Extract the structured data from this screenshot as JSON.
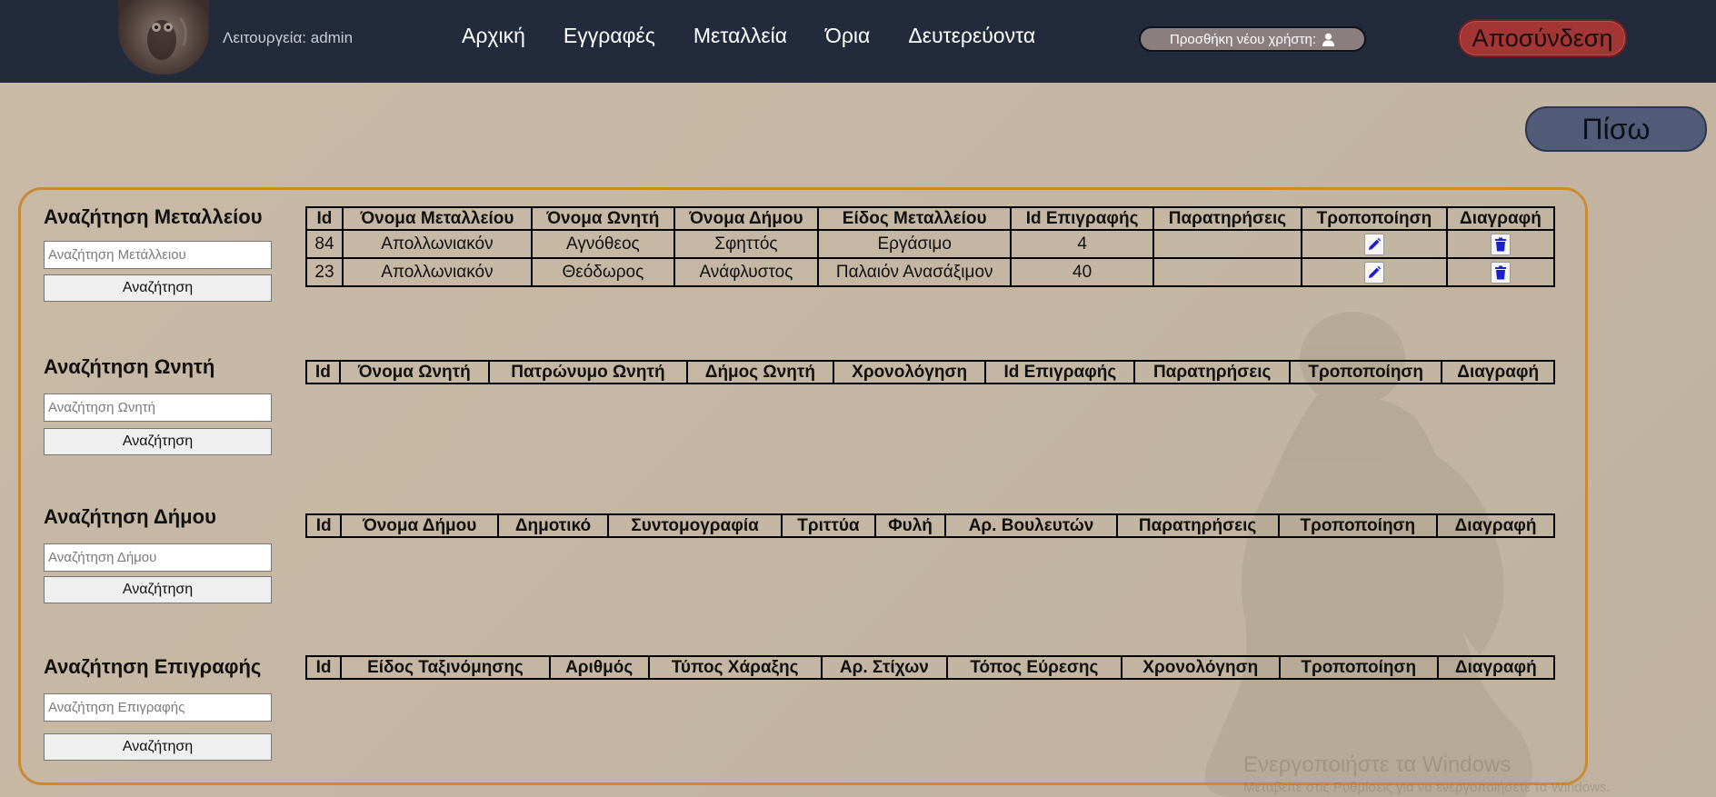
{
  "header": {
    "role_text": "Λειτουργεία: admin",
    "nav": [
      "Αρχική",
      "Εγγραφές",
      "Μεταλλεία",
      "Όρια",
      "Δευτερεύοντα"
    ],
    "add_user_label": "Προσθήκη νέου χρήστη:",
    "logout_label": "Αποσύνδεση"
  },
  "back_label": "Πίσω",
  "sections": {
    "mines": {
      "title": "Αναζήτηση Μεταλλείου",
      "placeholder": "Αναζήτηση Μετάλλειου",
      "button": "Αναζήτηση",
      "columns": [
        "Id",
        "Όνομα Μεταλλείου",
        "Όνομα Ωνητή",
        "Όνομα Δήμου",
        "Είδος Μεταλλείου",
        "Id Επιγραφής",
        "Παρατηρήσεις",
        "Τροποποίηση",
        "Διαγραφή"
      ],
      "rows": [
        [
          "84",
          "Απολλωνιακόν",
          "Αγνόθεος",
          "Σφηττός",
          "Εργάσιμο",
          "4",
          ""
        ],
        [
          "23",
          "Απολλωνιακόν",
          "Θεόδωρος",
          "Ανάφλυστος",
          "Παλαιόν Ανασάξιμον",
          "40",
          ""
        ]
      ]
    },
    "buyers": {
      "title": "Αναζήτηση Ωνητή",
      "placeholder": "Αναζήτηση Ωνητή",
      "button": "Αναζήτηση",
      "columns": [
        "Id",
        "Όνομα Ωνητή",
        "Πατρώνυμο Ωνητή",
        "Δήμος Ωνητή",
        "Χρονολόγηση",
        "Id Επιγραφής",
        "Παρατηρήσεις",
        "Τροποποίηση",
        "Διαγραφή"
      ]
    },
    "demes": {
      "title": "Αναζήτηση Δήμου",
      "placeholder": "Αναζήτηση Δήμου",
      "button": "Αναζήτηση",
      "columns": [
        "Id",
        "Όνομα Δήμου",
        "Δημοτικό",
        "Συντομογραφία",
        "Τριττύα",
        "Φυλή",
        "Αρ. Βουλευτών",
        "Παρατηρήσεις",
        "Τροποποίηση",
        "Διαγραφή"
      ]
    },
    "inscriptions": {
      "title": "Αναζήτηση Επιγραφής",
      "placeholder": "Αναζήτηση Επιγραφής",
      "button": "Αναζήτηση",
      "columns": [
        "Id",
        "Είδος Ταξινόμησης",
        "Αριθμός",
        "Τύπος Χάραξης",
        "Αρ. Στίχων",
        "Τόπος Εύρεσης",
        "Χρονολόγηση",
        "Τροποποίηση",
        "Διαγραφή"
      ]
    }
  },
  "watermark": {
    "line1": "Ενεργοποιήστε τα Windows",
    "line2": "Μεταβείτε στις Ρυθμίσεις για να ενεργοποιήσετε τα Windows."
  },
  "colors": {
    "navbar": "#222a3b",
    "panel_border": "#c98a35",
    "logout": "#a43535",
    "back": "#505c78",
    "icon_blue": "#1a1fcf"
  },
  "icons": {
    "edit": "pencil-icon",
    "delete": "trash-icon",
    "user": "user-icon"
  }
}
